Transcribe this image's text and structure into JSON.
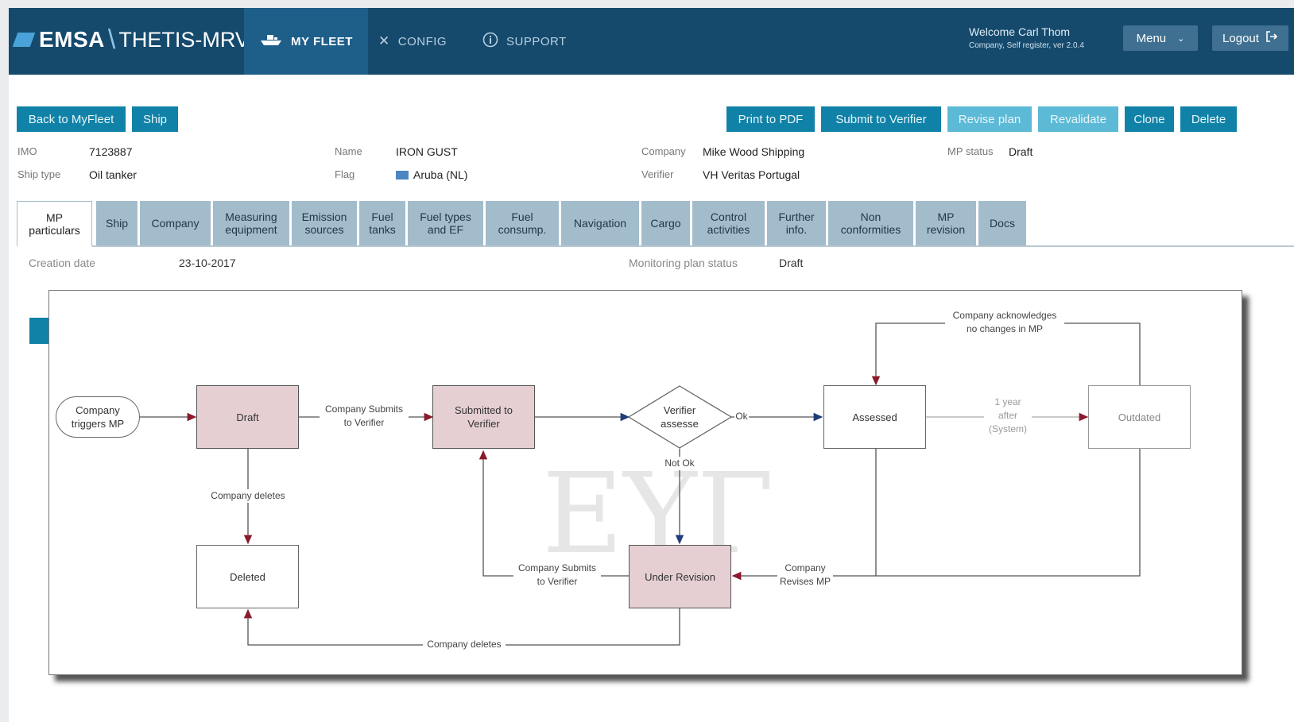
{
  "app": {
    "brand": "EMSA",
    "product": "THETIS-MRV"
  },
  "nav": {
    "my_fleet": "MY FLEET",
    "config": "CONFIG",
    "support": "SUPPORT"
  },
  "user": {
    "welcome": "Welcome Carl Thom",
    "detail": "Company, Self register, ver 2.0.4",
    "menu": "Menu",
    "logout": "Logout"
  },
  "actions": {
    "back": "Back to MyFleet",
    "ship": "Ship",
    "print": "Print to PDF",
    "submit": "Submit to Verifier",
    "revise": "Revise plan",
    "revalidate": "Revalidate",
    "clone": "Clone",
    "delete": "Delete"
  },
  "ship_info": {
    "imo_label": "IMO",
    "imo": "7123887",
    "ship_type_label": "Ship type",
    "ship_type": "Oil tanker",
    "name_label": "Name",
    "name": "IRON GUST",
    "flag_label": "Flag",
    "flag": "Aruba (NL)",
    "company_label": "Company",
    "company": "Mike Wood Shipping",
    "verifier_label": "Verifier",
    "verifier": "VH Veritas Portugal",
    "mp_status_label": "MP status",
    "mp_status": "Draft"
  },
  "tabs": [
    {
      "line1": "MP",
      "line2": "particulars"
    },
    {
      "line1": "Ship",
      "line2": ""
    },
    {
      "line1": "Company",
      "line2": ""
    },
    {
      "line1": "Measuring",
      "line2": "equipment"
    },
    {
      "line1": "Emission",
      "line2": "sources"
    },
    {
      "line1": "Fuel",
      "line2": "tanks"
    },
    {
      "line1": "Fuel types",
      "line2": "and EF"
    },
    {
      "line1": "Fuel",
      "line2": "consump."
    },
    {
      "line1": "Navigation",
      "line2": ""
    },
    {
      "line1": "Cargo",
      "line2": ""
    },
    {
      "line1": "Control",
      "line2": "activities"
    },
    {
      "line1": "Further",
      "line2": "info."
    },
    {
      "line1": "Non",
      "line2": "conformities"
    },
    {
      "line1": "MP",
      "line2": "revision"
    },
    {
      "line1": "Docs",
      "line2": ""
    }
  ],
  "meta": {
    "creation_label": "Creation date",
    "creation_date": "23-10-2017",
    "status_label": "Monitoring plan status",
    "status": "Draft"
  },
  "diagram": {
    "start": {
      "line1": "Company",
      "line2": "triggers MP"
    },
    "draft": "Draft",
    "submitted": {
      "line1": "Submitted to",
      "line2": "Verifier"
    },
    "verifier": {
      "line1": "Verifier",
      "line2": "assesse"
    },
    "assessed": "Assessed",
    "outdated": "Outdated",
    "deleted": "Deleted",
    "under_revision": "Under Revision",
    "labels": {
      "submit1": {
        "line1": "Company Submits",
        "line2": "to Verifier"
      },
      "ok": "Ok",
      "not_ok": "Not Ok",
      "acknowledges": {
        "line1": "Company acknowledges",
        "line2": "no changes in MP"
      },
      "year": {
        "line1": "1 year",
        "line2": "after",
        "line3": "(System)"
      },
      "deletes1": "Company deletes",
      "submit2": {
        "line1": "Company Submits",
        "line2": "to Verifier"
      },
      "revises": {
        "line1": "Company",
        "line2": "Revises MP"
      },
      "deletes2": "Company deletes"
    }
  },
  "colors": {
    "header": "#154a6d",
    "button": "#1182a7",
    "button_light": "#5cbad6",
    "tab": "#a3bccb",
    "node_pink": "#e5cfd3",
    "arrow": "#8b1a2b"
  },
  "icons": {
    "ship": "ship-icon",
    "config": "tools-icon",
    "support": "info-icon",
    "menu": "chevron-down-icon",
    "logout": "logout-icon",
    "flag": "flag-icon"
  }
}
